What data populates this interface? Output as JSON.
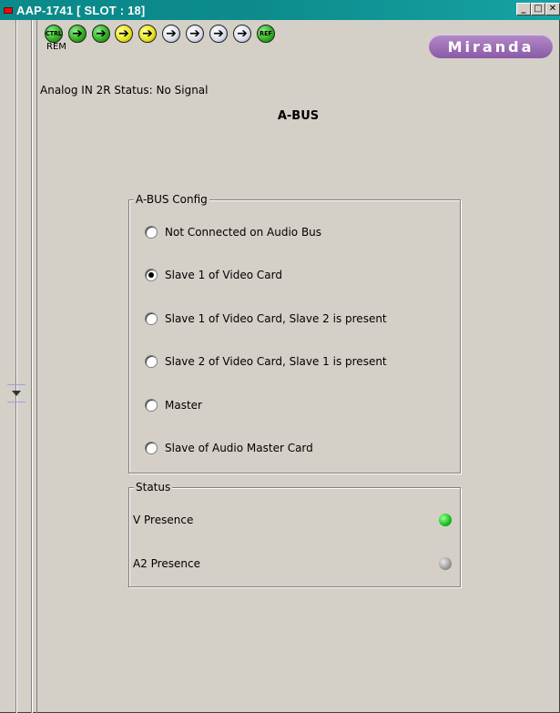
{
  "window": {
    "title": "AAP-1741 [ SLOT : 18]"
  },
  "header": {
    "icons": [
      {
        "name": "ctrl-icon",
        "label": "CTRL",
        "color": "green"
      },
      {
        "name": "arrow-icon-1",
        "label": "➔",
        "color": "green"
      },
      {
        "name": "arrow-icon-2",
        "label": "➔",
        "color": "green"
      },
      {
        "name": "arrow-icon-3",
        "label": "➔",
        "color": "yellow"
      },
      {
        "name": "arrow-icon-4",
        "label": "➔",
        "color": "yellow"
      },
      {
        "name": "arrow-icon-5",
        "label": "➔",
        "color": "white"
      },
      {
        "name": "arrow-icon-6",
        "label": "➔",
        "color": "white"
      },
      {
        "name": "arrow-icon-7",
        "label": "➔",
        "color": "white"
      },
      {
        "name": "arrow-icon-8",
        "label": "➔",
        "color": "white"
      },
      {
        "name": "ref-icon",
        "label": "REF",
        "color": "green"
      }
    ],
    "rem_label": "REM",
    "logo": "Miranda",
    "status_line": "Analog IN 2R Status: No Signal"
  },
  "section_title": "A-BUS",
  "abus_config": {
    "title": "A-BUS Config",
    "options": [
      {
        "label": "Not Connected on Audio Bus",
        "checked": false
      },
      {
        "label": "Slave 1 of Video Card",
        "checked": true
      },
      {
        "label": "Slave 1 of Video Card, Slave 2 is present",
        "checked": false
      },
      {
        "label": "Slave 2 of Video Card, Slave 1 is present",
        "checked": false
      },
      {
        "label": "Master",
        "checked": false
      },
      {
        "label": "Slave of Audio Master Card",
        "checked": false
      }
    ]
  },
  "status": {
    "title": "Status",
    "items": [
      {
        "label": "V Presence",
        "state": "on",
        "color": "#22c422"
      },
      {
        "label": "A2 Presence",
        "state": "off",
        "color": "#a0a0a0"
      }
    ]
  }
}
